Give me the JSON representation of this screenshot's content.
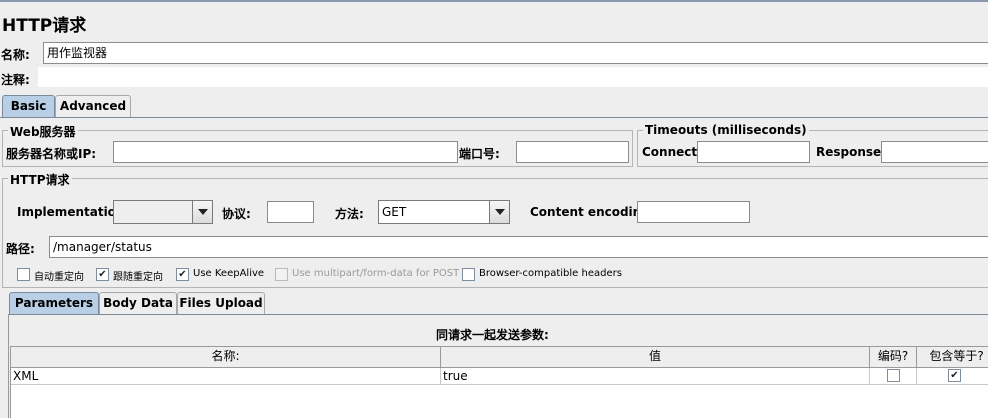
{
  "title": "HTTP请求",
  "name_label": "名称:",
  "name_value": "用作监视器",
  "comment_label": "注释:",
  "comment_value": "",
  "tabs": [
    {
      "label": "Basic",
      "active": true
    },
    {
      "label": "Advanced",
      "active": false
    }
  ],
  "web_server": {
    "title": "Web服务器",
    "server_label": "服务器名称或IP:",
    "server_value": "",
    "port_label": "端口号:",
    "port_value": ""
  },
  "timeouts": {
    "title": "Timeouts (milliseconds)",
    "connect_label": "Connect:",
    "connect_value": "",
    "response_label": "Response:",
    "response_value": ""
  },
  "http_request": {
    "title": "HTTP请求",
    "implementation_label": "Implementation:",
    "implementation_value": "",
    "protocol_label": "协议:",
    "protocol_value": "",
    "method_label": "方法:",
    "method_value": "GET",
    "encoding_label": "Content encoding:",
    "encoding_value": "",
    "path_label": "路径:",
    "path_value": "/manager/status"
  },
  "checkboxes": [
    {
      "label": "自动重定向",
      "checked": false,
      "disabled": false
    },
    {
      "label": "跟随重定向",
      "checked": true,
      "disabled": false
    },
    {
      "label": "Use KeepAlive",
      "checked": true,
      "disabled": false
    },
    {
      "label": "Use multipart/form-data for POST",
      "checked": false,
      "disabled": true
    },
    {
      "label": "Browser-compatible headers",
      "checked": false,
      "disabled": false
    }
  ],
  "sub_tabs": [
    {
      "label": "Parameters",
      "active": true
    },
    {
      "label": "Body Data",
      "active": false
    },
    {
      "label": "Files Upload",
      "active": false
    }
  ],
  "params": {
    "heading": "同请求一起发送参数:",
    "columns": [
      "名称:",
      "值",
      "编码?",
      "包含等于?"
    ],
    "rows": [
      {
        "name": "XML",
        "value": "true",
        "encode": false,
        "include_equals": true
      }
    ]
  }
}
